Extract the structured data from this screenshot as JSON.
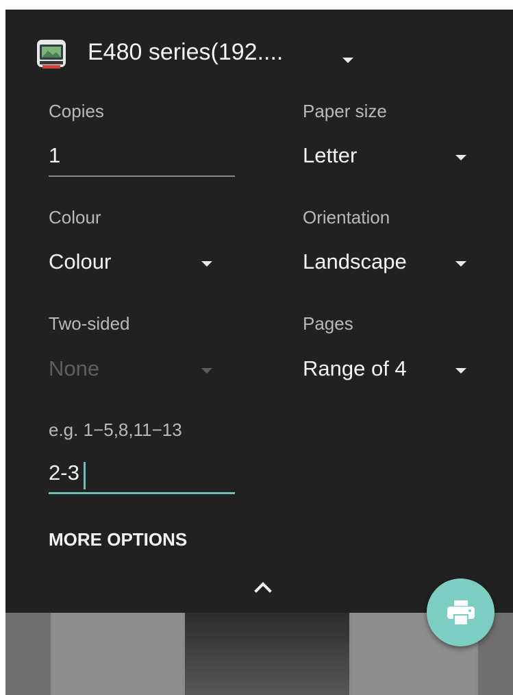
{
  "printer": {
    "name": "E480 series(192....",
    "icon": "printer-app-icon"
  },
  "fields": {
    "copies": {
      "label": "Copies",
      "value": "1"
    },
    "paper_size": {
      "label": "Paper size",
      "value": "Letter"
    },
    "colour": {
      "label": "Colour",
      "value": "Colour"
    },
    "orientation": {
      "label": "Orientation",
      "value": "Landscape"
    },
    "two_sided": {
      "label": "Two-sided",
      "value": "None",
      "enabled": false
    },
    "pages": {
      "label": "Pages",
      "value": "Range of 4"
    },
    "page_range": {
      "hint": "e.g. 1−5,8,11−13",
      "value": "2-3"
    }
  },
  "more_options_label": "MORE OPTIONS",
  "colors": {
    "background": "#212121",
    "accent": "#6ebfb4",
    "fab": "#7ecdc3",
    "text_primary": "#f4f4f4",
    "text_secondary": "#b9b9b9",
    "text_disabled": "#5e5e5e"
  },
  "icons": {
    "collapse": "chevron-up-icon",
    "print": "print-icon",
    "dropdown": "dropdown-arrow-icon"
  }
}
